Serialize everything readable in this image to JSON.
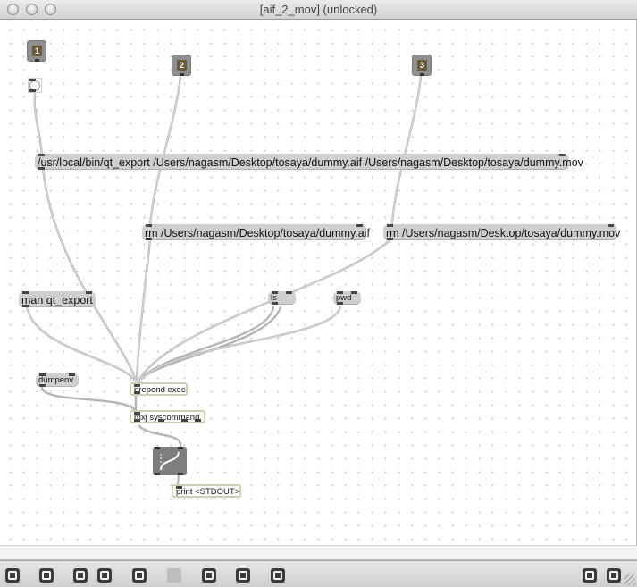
{
  "window": {
    "title": "[aif_2_mov] (unlocked)"
  },
  "inlets": [
    {
      "label": "1"
    },
    {
      "label": "2"
    },
    {
      "label": "3"
    }
  ],
  "messages": {
    "qt_export": "/usr/local/bin/qt_export /Users/nagasm/Desktop/tosaya/dummy.aif /Users/nagasm/Desktop/tosaya/dummy.mov",
    "rm_aif": "rm /Users/nagasm/Desktop/tosaya/dummy.aif",
    "rm_mov": "rm /Users/nagasm/Desktop/tosaya/dummy.mov",
    "man": "man qt_export",
    "ls": "ls",
    "pwd": "pwd",
    "dumpenv": "dumpenv"
  },
  "objects": {
    "prepend": "prepend exec",
    "syscommand": "mxj syscommand",
    "print": "print <STDOUT>"
  },
  "toolbar": {
    "icons": [
      "new-object-icon",
      "new-patcher-icon",
      "paste-icon",
      "clear-icon",
      "trace-icon",
      "info-icon",
      "lock-icon",
      "grid-icon",
      "inspector-icon",
      "show-toolbar-icon",
      "presentation-icon"
    ]
  }
}
